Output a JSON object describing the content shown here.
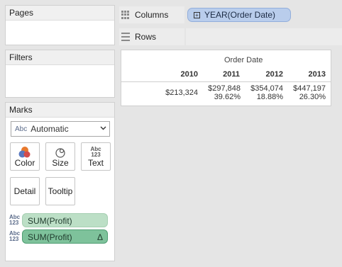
{
  "pages": {
    "title": "Pages"
  },
  "filters": {
    "title": "Filters"
  },
  "marks": {
    "title": "Marks",
    "mark_type": {
      "abc_icon": "Abc",
      "selected": "Automatic"
    },
    "buttons": [
      {
        "label": "Color",
        "icon": "color-icon"
      },
      {
        "label": "Size",
        "icon": "size-icon"
      },
      {
        "label": "Text",
        "icon": "text-icon",
        "icon_text_top": "Abc",
        "icon_text_bottom": "123"
      },
      {
        "label": "Detail",
        "icon": "detail-icon"
      },
      {
        "label": "Tooltip",
        "icon": "tooltip-icon"
      }
    ],
    "fields": [
      {
        "type_top": "Abc",
        "type_bottom": "123",
        "label": "SUM(Profit)",
        "delta": ""
      },
      {
        "type_top": "Abc",
        "type_bottom": "123",
        "label": "SUM(Profit)",
        "delta": "Δ"
      }
    ]
  },
  "shelves": {
    "columns": {
      "label": "Columns",
      "pill": "YEAR(Order Date)",
      "pill_expand": "+"
    },
    "rows": {
      "label": "Rows"
    }
  },
  "view": {
    "field_header": "Order Date",
    "years": [
      "2010",
      "2011",
      "2012",
      "2013"
    ],
    "values": [
      "$213,324",
      "$297,848",
      "$354,074",
      "$447,197"
    ],
    "percent_changes": [
      "",
      "39.62%",
      "18.88%",
      "26.30%"
    ]
  },
  "colors": {
    "dimension_pill": "#b9cdec",
    "measure_pill_light": "#bcdfc6",
    "measure_pill_dark": "#7ec29b"
  }
}
